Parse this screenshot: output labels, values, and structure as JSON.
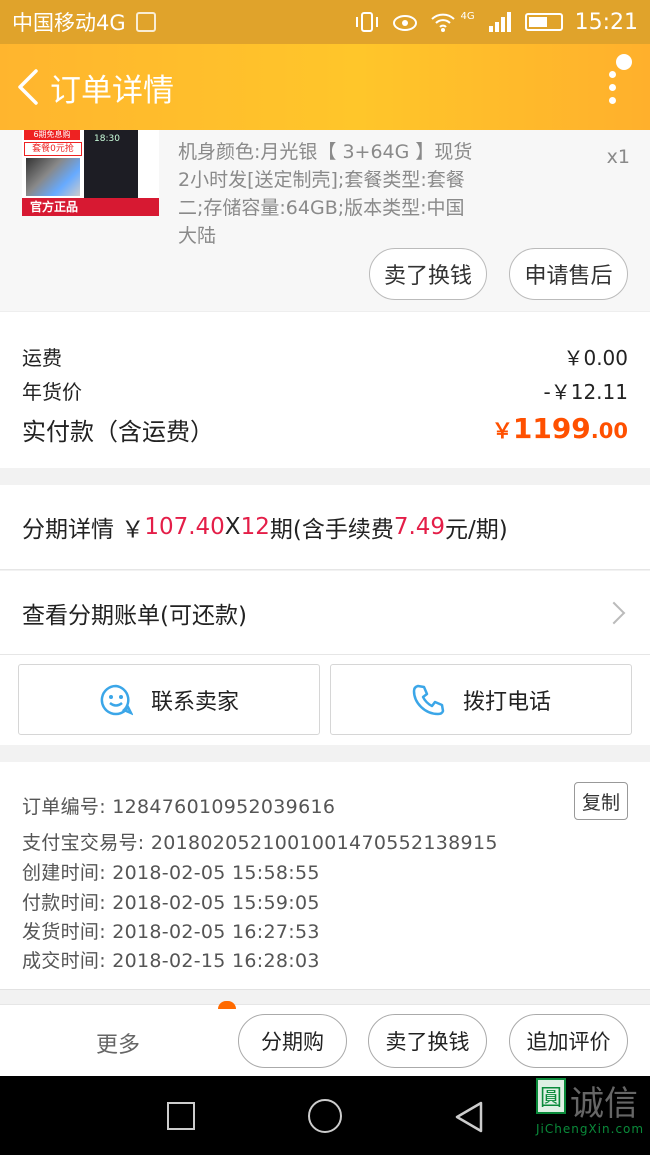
{
  "status_bar": {
    "carrier": "中国移动4G",
    "network": "4G",
    "time": "15:21"
  },
  "nav": {
    "title": "订单详情"
  },
  "product": {
    "spec": "机身颜色:月光银【 3+64G 】现货2小时发[送定制壳];套餐类型:套餐二;存储容量:64GB;版本类型:中国大陆",
    "quantity": "x1",
    "thumb_time": "18:30",
    "thumb_promo_top": "6期免息购",
    "thumb_promo_mid": "套餐0元抢",
    "thumb_promo_bottom": "官方正品",
    "sell_button": "卖了换钱",
    "after_sale_button": "申请售后"
  },
  "fees": {
    "shipping_label": "运费",
    "shipping_value": "￥0.00",
    "discount_label": "年货价",
    "discount_value": "-￥12.11",
    "total_label": "实付款（含运费）",
    "total_currency": "￥",
    "total_int": "1199",
    "total_dec": ".00"
  },
  "installment": {
    "prefix": "分期详情 ￥",
    "amount": "107.40",
    "x": "X",
    "periods": "12",
    "mid": "期(含手续费",
    "fee": "7.49",
    "suffix": "元/期)"
  },
  "bill": {
    "label": "查看分期账单(可还款)"
  },
  "contact": {
    "seller_label": "联系卖家",
    "phone_label": "拨打电话"
  },
  "order_info": {
    "order_no": "订单编号: 128476010952039616",
    "alipay_no": "支付宝交易号: 2018020521001001470552138915",
    "created": "创建时间: 2018-02-05 15:58:55",
    "paid": "付款时间: 2018-02-05 15:59:05",
    "shipped": "发货时间: 2018-02-05 16:27:53",
    "completed": "成交时间: 2018-02-15 16:28:03",
    "copy_button": "复制"
  },
  "bottom_bar": {
    "more": "更多",
    "installment_buy": "分期购",
    "sell": "卖了换钱",
    "add_review": "追加评价"
  },
  "watermark": {
    "glyph": "圓",
    "text": "诚信",
    "sub": "JiChengXin.com"
  },
  "colors": {
    "header_orange": "#ffb52e",
    "status_bar": "#e0a32b",
    "price_orange": "#ff5000",
    "installment_red": "#e41e48",
    "icon_blue": "#3ba6e8"
  }
}
